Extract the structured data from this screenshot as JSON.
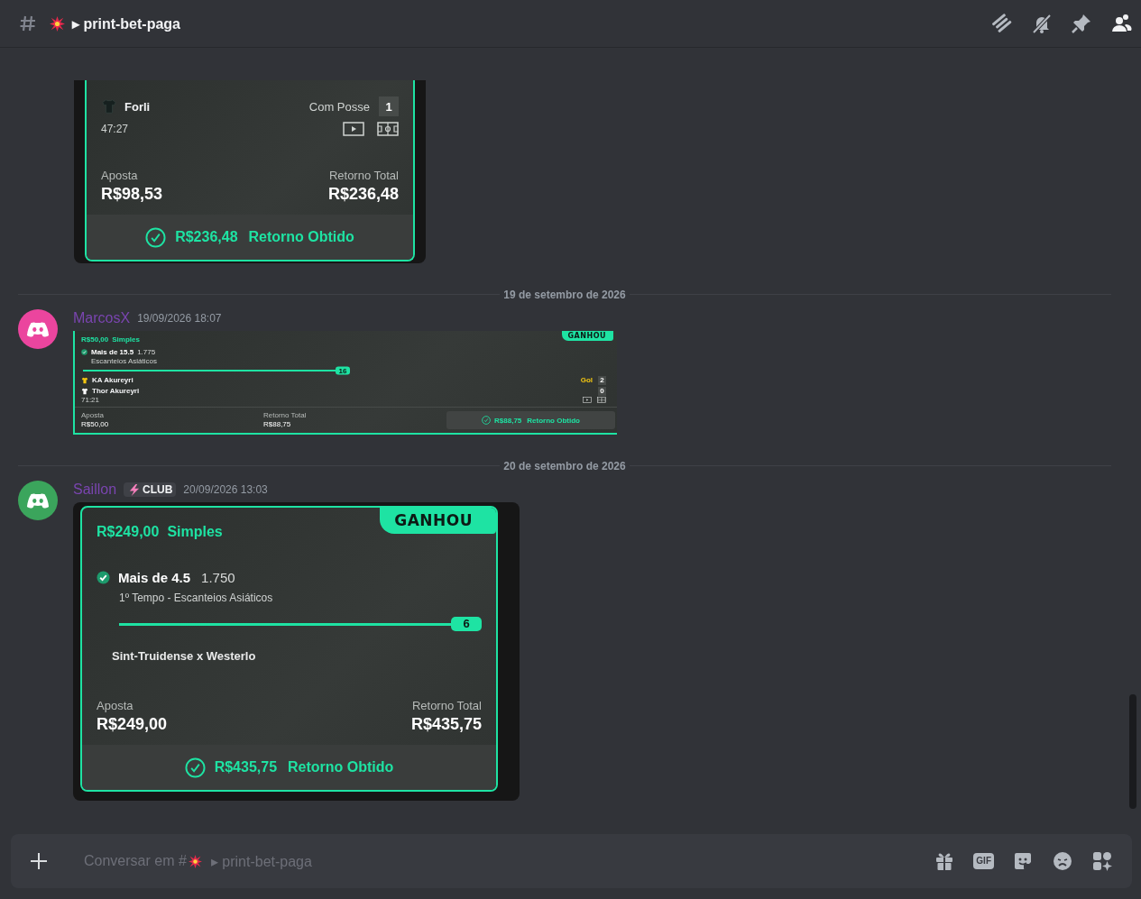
{
  "header": {
    "channel": "▸ print-bet-paga"
  },
  "top_card": {
    "teams": [
      {
        "name": "Forli",
        "color": "#16201f",
        "event": "Com Posse",
        "event_highlight": false,
        "score": "1"
      }
    ],
    "clock": "47:27",
    "stake_label": "Aposta",
    "stake_value": "R$98,53",
    "return_label": "Retorno Total",
    "return_value": "R$236,48",
    "result_value": "R$236,48",
    "result_label": "Retorno Obtido"
  },
  "feed": [
    {
      "kind": "divider",
      "label": "19 de setembro de 2026"
    },
    {
      "kind": "message",
      "author": "MarcosX",
      "color": "#eb459e",
      "timestamp": "19/09/2026 18:07",
      "card": {
        "kind": "compact",
        "status": "GANHOU",
        "stake": "R$50,00",
        "bet_type": "Simples",
        "selection": {
          "checked": true,
          "name": "Mais de 15.5",
          "odds": "1.775",
          "market": "Escanteios Asiáticos",
          "level": 1,
          "count": "16"
        },
        "teams": [
          {
            "name": "KA Akureyri",
            "color": "#f2c511",
            "event": "Gol",
            "event_highlight": true,
            "score": "2"
          },
          {
            "name": "Thor Akureyri",
            "color": "#ffffff",
            "score": "0"
          }
        ],
        "clock": "71:21",
        "stake_label": "Aposta",
        "stake_value": "R$50,00",
        "return_label": "Retorno Total",
        "return_value": "R$88,75",
        "result_value": "R$88,75",
        "result_label": "Retorno Obtido"
      }
    },
    {
      "kind": "divider",
      "label": "20 de setembro de 2026"
    },
    {
      "kind": "message",
      "author": "Saillon",
      "color": "#3ba55c",
      "badge": "CLUB",
      "timestamp": "20/09/2026 13:03",
      "card": {
        "kind": "full",
        "status": "GANHOU",
        "stake": "R$249,00",
        "bet_type": "Simples",
        "selection": {
          "checked": true,
          "name": "Mais de 4.5",
          "odds": "1.750",
          "market": "1º Tempo - Escanteios Asiáticos",
          "level": 1,
          "count": "6"
        },
        "match": "Sint-Truidense x Westerlo",
        "stake_label": "Aposta",
        "stake_value": "R$249,00",
        "return_label": "Retorno Total",
        "return_value": "R$435,75",
        "result_value": "R$435,75",
        "result_label": "Retorno Obtido"
      }
    }
  ],
  "composer": {
    "prompt": "Conversar em #",
    "channel": "▸ print-bet-paga",
    "gif_label": "GIF"
  }
}
